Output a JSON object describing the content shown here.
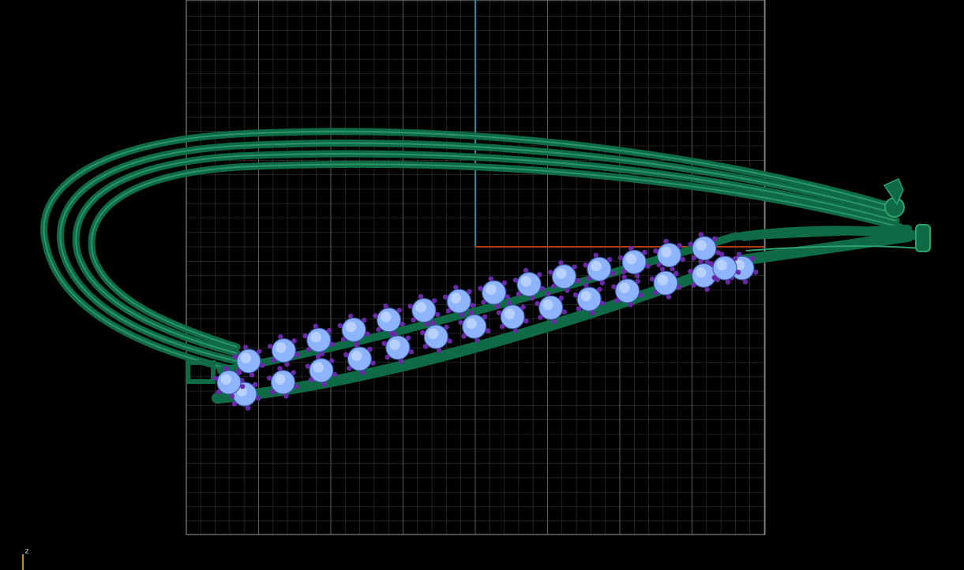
{
  "viewport": {
    "background": "#000000",
    "grid_color": "#6f6f6f",
    "axis_x_color": "#b23a14",
    "axis_y_color": "#1e8fa6",
    "axis_z_color": "#c98a2a",
    "model_color": "#0f6b46",
    "model_highlight": "#2fa070",
    "gem_color": "#8fb4ff",
    "prong_color": "#6a2aa8"
  },
  "axis_indicator": {
    "label": "z"
  }
}
